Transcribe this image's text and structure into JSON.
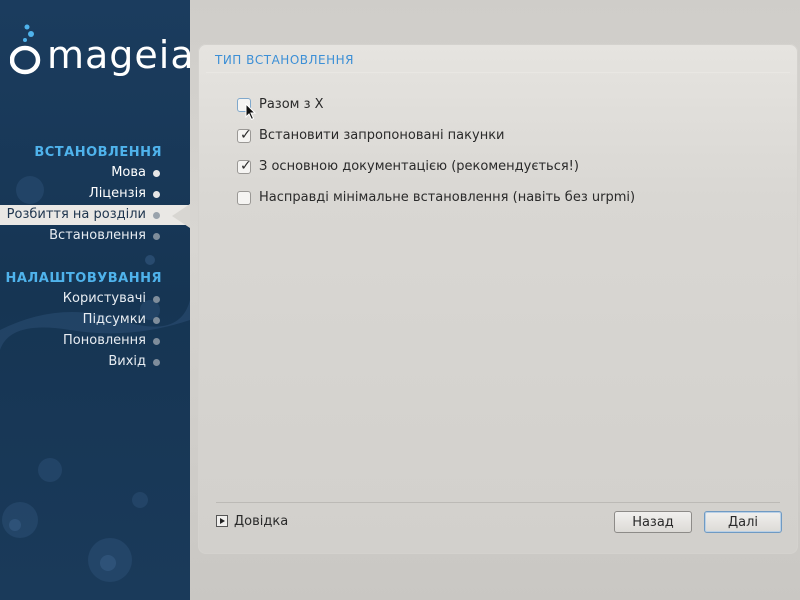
{
  "brand": {
    "name": "mageia"
  },
  "sidebar": {
    "sections": [
      {
        "heading": "ВСТАНОВЛЕННЯ",
        "items": [
          {
            "label": "Мова",
            "state": "done"
          },
          {
            "label": "Ліцензія",
            "state": "done"
          },
          {
            "label": "Розбиття на розділи",
            "state": "current"
          },
          {
            "label": "Встановлення",
            "state": "todo"
          }
        ]
      },
      {
        "heading": "НАЛАШТОВУВАННЯ",
        "items": [
          {
            "label": "Користувачі",
            "state": "todo"
          },
          {
            "label": "Підсумки",
            "state": "todo"
          },
          {
            "label": "Поновлення",
            "state": "todo"
          },
          {
            "label": "Вихід",
            "state": "todo"
          }
        ]
      }
    ]
  },
  "panel": {
    "title": "ТИП ВСТАНОВЛЕННЯ",
    "options": [
      {
        "label": "Разом з X",
        "checked": false
      },
      {
        "label": "Встановити запропоновані пакунки",
        "checked": true
      },
      {
        "label": "З основною документацією (рекомендується!)",
        "checked": true
      },
      {
        "label": "Насправді мінімальне встановлення (навіть без urpmi)",
        "checked": false
      }
    ],
    "help_label": "Довідка",
    "back_label": "Назад",
    "next_label": "Далі"
  },
  "colors": {
    "sidebar_bg": "#1b3c5e",
    "heading_accent": "#4fb3ec",
    "title_accent": "#3c8fd6"
  }
}
